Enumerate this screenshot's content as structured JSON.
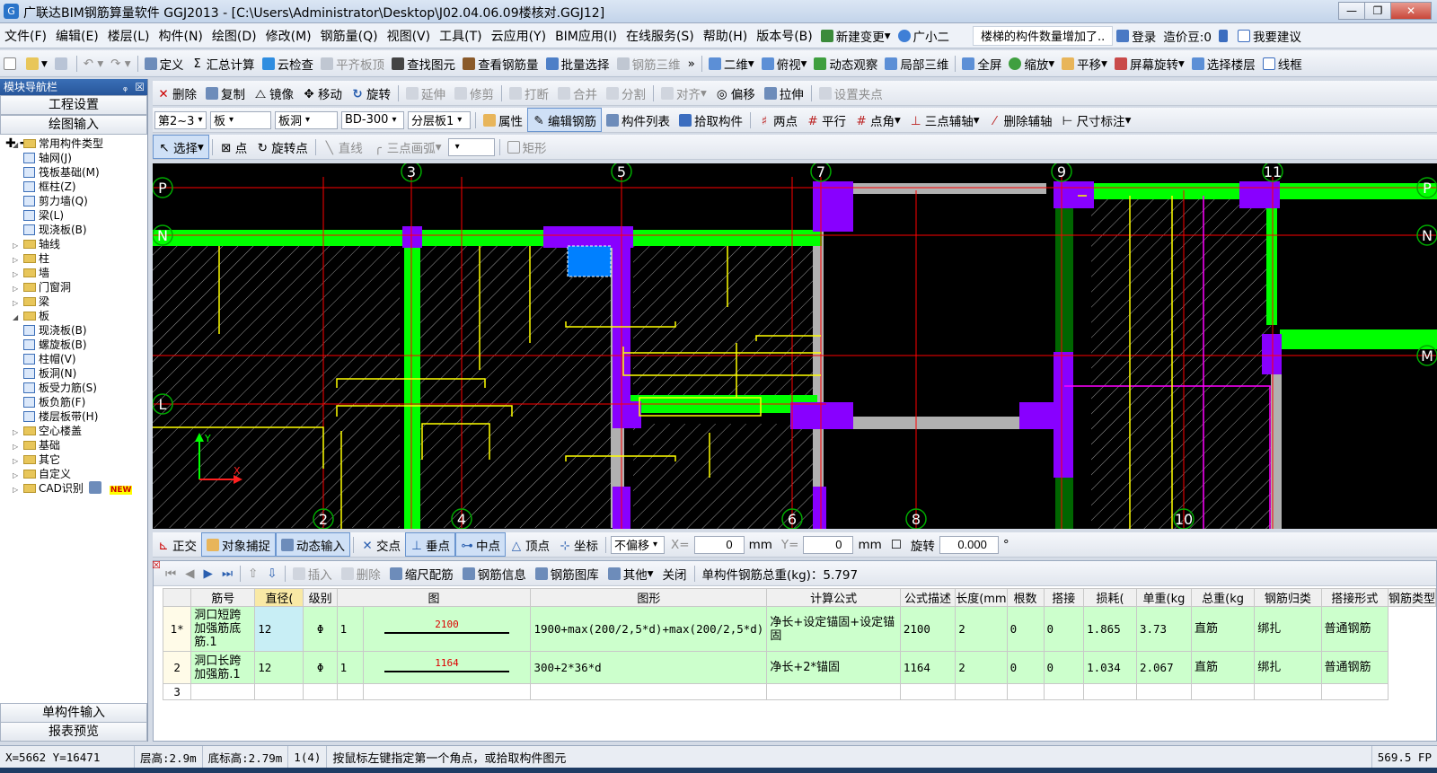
{
  "titlebar": {
    "title": "广联达BIM钢筋算量软件 GGJ2013 - [C:\\Users\\Administrator\\Desktop\\J02.04.06.09楼核对.GGJ12]",
    "icon": "app-icon"
  },
  "menubar": {
    "menus": [
      "文件(F)",
      "编辑(E)",
      "楼层(L)",
      "构件(N)",
      "绘图(D)",
      "修改(M)",
      "钢筋量(Q)",
      "视图(V)",
      "工具(T)",
      "云应用(Y)",
      "BIM应用(I)",
      "在线服务(S)",
      "帮助(H)",
      "版本号(B)"
    ],
    "new_change": "新建变更",
    "assistant": "广小二",
    "news": "楼梯的构件数量增加了..",
    "login": "登录",
    "price_bean": "造价豆:0",
    "suggest": "我要建议"
  },
  "toolbar1": {
    "items": [
      "定义",
      "汇总计算",
      "云检查",
      "平齐板顶",
      "查找图元",
      "查看钢筋量",
      "批量选择",
      "钢筋三维",
      "二维",
      "俯视",
      "动态观察",
      "局部三维",
      "全屏",
      "缩放",
      "平移",
      "屏幕旋转",
      "选择楼层",
      "线框"
    ]
  },
  "left_panel": {
    "header": "模块导航栏",
    "project_settings": "工程设置",
    "drawing_input": "绘图输入",
    "tree": [
      {
        "label": "常用构件类型",
        "level": 0,
        "open": true
      },
      {
        "label": "轴网(J)",
        "level": 1
      },
      {
        "label": "筏板基础(M)",
        "level": 1
      },
      {
        "label": "框柱(Z)",
        "level": 1
      },
      {
        "label": "剪力墙(Q)",
        "level": 1
      },
      {
        "label": "梁(L)",
        "level": 1
      },
      {
        "label": "现浇板(B)",
        "level": 1
      },
      {
        "label": "轴线",
        "level": 0
      },
      {
        "label": "柱",
        "level": 0
      },
      {
        "label": "墙",
        "level": 0
      },
      {
        "label": "门窗洞",
        "level": 0
      },
      {
        "label": "梁",
        "level": 0
      },
      {
        "label": "板",
        "level": 0,
        "open": true
      },
      {
        "label": "现浇板(B)",
        "level": 1
      },
      {
        "label": "螺旋板(B)",
        "level": 1
      },
      {
        "label": "柱帽(V)",
        "level": 1
      },
      {
        "label": "板洞(N)",
        "level": 1
      },
      {
        "label": "板受力筋(S)",
        "level": 1
      },
      {
        "label": "板负筋(F)",
        "level": 1
      },
      {
        "label": "楼层板带(H)",
        "level": 1
      },
      {
        "label": "空心楼盖",
        "level": 0
      },
      {
        "label": "基础",
        "level": 0
      },
      {
        "label": "其它",
        "level": 0
      },
      {
        "label": "自定义",
        "level": 0
      },
      {
        "label": "CAD识别",
        "level": 0,
        "badge": "NEW"
      }
    ],
    "single_input": "单构件输入",
    "report_preview": "报表预览"
  },
  "toolbar2": {
    "items": [
      "删除",
      "复制",
      "镜像",
      "移动",
      "旋转",
      "延伸",
      "修剪",
      "打断",
      "合并",
      "分割",
      "对齐",
      "偏移",
      "拉伸",
      "设置夹点"
    ]
  },
  "toolbar3": {
    "floor": "第2~3",
    "category": "板",
    "type": "板洞",
    "member": "BD-300",
    "layer": "分层板1",
    "items": [
      "属性",
      "编辑钢筋",
      "构件列表",
      "拾取构件",
      "两点",
      "平行",
      "点角",
      "三点辅轴",
      "删除辅轴",
      "尺寸标注"
    ]
  },
  "toolbar4": {
    "items": [
      "选择",
      "点",
      "旋转点",
      "直线",
      "三点画弧",
      "矩形"
    ]
  },
  "canvas": {
    "axis_top": [
      "3",
      "5",
      "7",
      "9",
      "11"
    ],
    "axis_bottom": [
      "2",
      "4",
      "6",
      "8",
      "10"
    ],
    "axis_left": [
      "P",
      "N",
      "L"
    ],
    "axis_right": [
      "P",
      "N",
      "M"
    ]
  },
  "snapbar": {
    "items": [
      "正交",
      "对象捕捉",
      "动态输入",
      "交点",
      "垂点",
      "中点",
      "顶点",
      "坐标"
    ],
    "offset": "不偏移",
    "x_label": "X=",
    "x_value": "0",
    "y_label": "Y=",
    "y_value": "0",
    "unit": "mm",
    "rotate_label": "旋转",
    "rotate_value": "0.000",
    "degree": "°"
  },
  "rebar_panel": {
    "toolbar": [
      "插入",
      "删除",
      "缩尺配筋",
      "钢筋信息",
      "钢筋图库",
      "其他",
      "关闭"
    ],
    "total_label": "单构件钢筋总重(kg)：5.797",
    "columns": [
      "筋号",
      "直径(",
      "级别",
      "图",
      "图形",
      "计算公式",
      "公式描述",
      "长度(mm",
      "根数",
      "搭接",
      "损耗(",
      "单重(kg",
      "总重(kg",
      "钢筋归类",
      "搭接形式",
      "钢筋类型"
    ],
    "rows": [
      {
        "idx": "1*",
        "name": "洞口短跨加强筋底筋.1",
        "dia": "12",
        "grade": "Φ",
        "fig": "1",
        "shape_len": "2100",
        "formula": "1900+max(200/2,5*d)+max(200/2,5*d)",
        "desc": "净长+设定锚固+设定锚固",
        "length": "2100",
        "count": "2",
        "lap": "0",
        "loss": "0",
        "unit_w": "1.865",
        "total_w": "3.73",
        "cat": "直筋",
        "lap_type": "绑扎",
        "rebar_type": "普通钢筋"
      },
      {
        "idx": "2",
        "name": "洞口长跨加强筋.1",
        "dia": "12",
        "grade": "Φ",
        "fig": "1",
        "shape_len": "1164",
        "formula": "300+2*36*d",
        "desc": "净长+2*锚固",
        "length": "1164",
        "count": "2",
        "lap": "0",
        "loss": "0",
        "unit_w": "1.034",
        "total_w": "2.067",
        "cat": "直筋",
        "lap_type": "绑扎",
        "rebar_type": "普通钢筋"
      },
      {
        "idx": "3"
      }
    ]
  },
  "statusbar": {
    "coords": "X=5662 Y=16471",
    "floor_height": "层高:2.9m",
    "bottom_elev": "底标高:2.79m",
    "count": "1(4)",
    "hint": "按鼠标左键指定第一个角点，或拾取构件图元",
    "fps": "569.5 FP"
  }
}
